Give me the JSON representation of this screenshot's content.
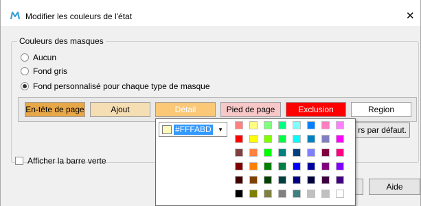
{
  "window": {
    "title": "Modifier les couleurs de l'état",
    "close_glyph": "✕"
  },
  "colors": {
    "group_header": "Couleurs des masques",
    "options": [
      {
        "label": "Aucun",
        "selected": false
      },
      {
        "label": "Fond gris",
        "selected": false
      },
      {
        "label": "Fond personnalisé pour chaque type de masque",
        "selected": true
      }
    ],
    "masks": [
      {
        "label": "En-tête de page",
        "bg": "#e8a848",
        "fg": "#000000"
      },
      {
        "label": "Ajout",
        "bg": "#f5deb3",
        "fg": "#000000"
      },
      {
        "label": "Détail",
        "bg": "#fbc878",
        "fg": "#ffffff"
      },
      {
        "label": "Pied de page",
        "bg": "#f8c8c8",
        "fg": "#000000"
      },
      {
        "label": "Exclusion",
        "bg": "#ff0000",
        "fg": "#ffffff"
      },
      {
        "label": "Region",
        "bg": "#ffffff",
        "fg": "#000000"
      }
    ],
    "defaults_button": "rs par défaut."
  },
  "green_bar": {
    "label": "Afficher la barre verte",
    "checked": false
  },
  "buttons": {
    "help": "Aide"
  },
  "color_picker": {
    "current_value": "#FFFABD",
    "current_color": "#fffabd",
    "dropdown_glyph": "▼",
    "palette": [
      [
        "#ff8080",
        "#ffff80",
        "#80ff80",
        "#00ff80",
        "#80ffff",
        "#0080ff",
        "#ff80c0",
        "#ff80ff"
      ],
      [
        "#ff0000",
        "#ffff00",
        "#80ff00",
        "#00ff40",
        "#00ffff",
        "#0080c0",
        "#8080c0",
        "#ff00ff"
      ],
      [
        "#804040",
        "#ff8040",
        "#00ff00",
        "#008080",
        "#004080",
        "#8080ff",
        "#800040",
        "#ff0080"
      ],
      [
        "#800000",
        "#ff8000",
        "#008000",
        "#008040",
        "#0000ff",
        "#0000a0",
        "#800080",
        "#8000ff"
      ],
      [
        "#400000",
        "#804000",
        "#004000",
        "#004040",
        "#000080",
        "#000040",
        "#400040",
        "#400080"
      ],
      [
        "#000000",
        "#808000",
        "#808040",
        "#808080",
        "#408080",
        "#c0c0c0",
        "#c0c0c0",
        "#ffffff"
      ]
    ]
  }
}
